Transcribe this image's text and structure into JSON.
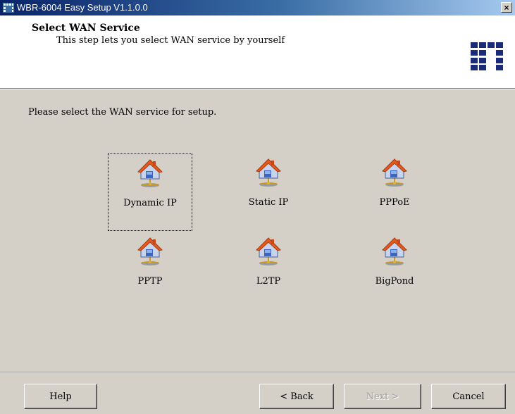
{
  "window": {
    "title": "WBR-6004 Easy Setup  V1.1.0.0",
    "close_label": "×"
  },
  "header": {
    "title": "Select WAN Service",
    "subtitle": "This step lets you select WAN service by yourself"
  },
  "main": {
    "prompt": "Please select the WAN service for setup.",
    "services": [
      {
        "label": "Dynamic IP",
        "selected": true,
        "icon": "house-network-icon"
      },
      {
        "label": "Static IP",
        "selected": false,
        "icon": "house-network-icon"
      },
      {
        "label": "PPPoE",
        "selected": false,
        "icon": "house-network-icon"
      },
      {
        "label": "PPTP",
        "selected": false,
        "icon": "house-network-icon"
      },
      {
        "label": "L2TP",
        "selected": false,
        "icon": "house-network-icon"
      },
      {
        "label": "BigPond",
        "selected": false,
        "icon": "house-network-icon"
      }
    ]
  },
  "footer": {
    "help_label": "Help",
    "back_label": "< Back",
    "next_label": "Next >",
    "next_enabled": false,
    "cancel_label": "Cancel"
  }
}
